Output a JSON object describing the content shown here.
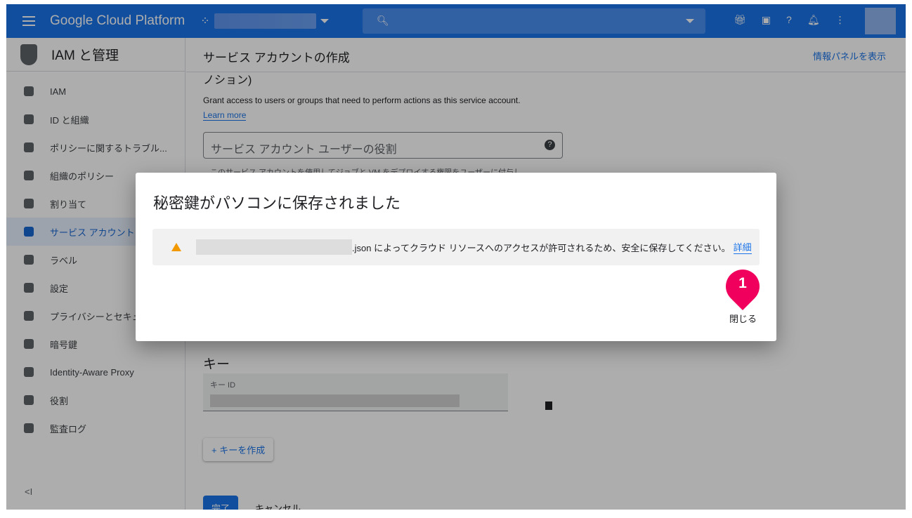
{
  "header": {
    "brand": "Google Cloud Platform"
  },
  "sidebar": {
    "title": "IAM と管理",
    "items": [
      {
        "label": "IAM"
      },
      {
        "label": "ID と組織"
      },
      {
        "label": "ポリシーに関するトラブル..."
      },
      {
        "label": "組織のポリシー"
      },
      {
        "label": "割り当て"
      },
      {
        "label": "サービス アカウント",
        "active": true
      },
      {
        "label": "ラベル"
      },
      {
        "label": "設定"
      },
      {
        "label": "プライバシーとセキュ"
      },
      {
        "label": "暗号鍵"
      },
      {
        "label": "Identity-Aware Proxy"
      },
      {
        "label": "役割"
      },
      {
        "label": "監査ログ"
      }
    ],
    "collapse": "<I"
  },
  "main": {
    "title": "サービス アカウントの作成",
    "info_panel": "情報パネルを表示",
    "section_tail": "ノション)",
    "grant_text": "Grant access to users or groups that need to perform actions as this service account.",
    "learn_more": "Learn more",
    "role_field": "サービス アカウント ユーザーの役割",
    "role_help": "このサービス アカウントを使用してジョブと VM をデプロイする権限をユーザーに付与し",
    "keys_heading": "キー",
    "key_id_label": "キー ID",
    "create_key": "キーを作成",
    "done": "完了",
    "cancel": "キャンセル"
  },
  "dialog": {
    "title": "秘密鍵がパソコンに保存されました",
    "message": ".json によってクラウド リソースへのアクセスが許可されるため、安全に保存してください。",
    "details": "詳細",
    "close": "閉じる",
    "marker": "1"
  },
  "colors": {
    "brand": "#1a73e8",
    "warning": "#f29900",
    "marker": "#f0005c"
  }
}
